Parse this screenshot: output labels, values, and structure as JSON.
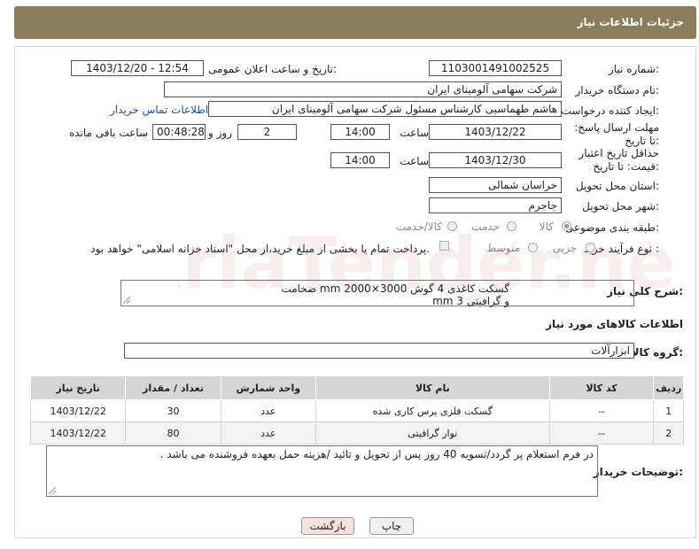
{
  "header": {
    "title": "جزئیات اطلاعات نیاز"
  },
  "form": {
    "need_number_label": "شماره نیاز:",
    "need_number": "1103001491002525",
    "announce_label": "تاریخ و ساعت اعلان عمومی:",
    "announce_value": "1403/12/20 - 12:54",
    "buyer_org_label": "نام دستگاه خریدار:",
    "buyer_org": "شرکت سهامی آلومینای ایران",
    "creator_label": "ایجاد کننده درخواست:",
    "creator": "هاشم طهماسبی کارشناس مسئول شرکت سهامی آلومینای ایران",
    "contact_link": "اطلاعات تماس خریدار",
    "reply_deadline_label": "مهلت ارسال پاسخ: تا تاریخ:",
    "reply_date": "1403/12/22",
    "time_label": "ساعت",
    "reply_time": "14:00",
    "days_value": "2",
    "days_label": "روز و",
    "remaining_value": "00:48:28",
    "remaining_label": "ساعت باقی مانده",
    "price_validity_label": "حداقل تاریخ اعتبار قیمت: تا تاریخ:",
    "validity_date": "1403/12/30",
    "validity_time": "14:00",
    "province_label": "استان محل تحویل:",
    "province": "خراسان شمالی",
    "city_label": "شهر محل تحویل:",
    "city": "جاجرم",
    "category_label": "طبقه بندی موضوعی:",
    "category_options": [
      "کالا",
      "خدمت",
      "کالا/خدمت"
    ],
    "process_label": "نوع فرآیند خرید :",
    "process_options": [
      "جزیی",
      "متوسط"
    ],
    "payment_note": "پرداخت تمام یا بخشی از مبلغ خرید،از محل \"اسناد خزانه اسلامی\" خواهد بود."
  },
  "description": {
    "label": "شرح کلی نیاز:",
    "line1": "گسکت کاغذی 4 گوش mm 2000×3000 ضخامت",
    "line2": "و گرافیتی mm 3"
  },
  "goods_info_title": "اطلاعات کالاهای مورد نیاز",
  "goods_group": {
    "label": "گروه کالا:",
    "value": "ابزارآلات"
  },
  "table": {
    "headers": [
      "ردیف",
      "کد کالا",
      "نام کالا",
      "واحد شمارش",
      "تعداد / مقدار",
      "تاریخ نیاز"
    ],
    "rows": [
      [
        "1",
        "--",
        "گسکت فلزی پرس کاری شده",
        "عدد",
        "30",
        "1403/12/22"
      ],
      [
        "2",
        "--",
        "نوار گرافیتی",
        "عدد",
        "80",
        "1403/12/22"
      ]
    ]
  },
  "buyer_notes": {
    "label": "توضیحات خریدار:",
    "text": "در فرم استعلام پر گردد/تسویه 40 روز پس از تحویل و تائید /هزینه حمل بعهده فروشنده می باشد ."
  },
  "buttons": {
    "print": "چاپ",
    "back": "بازگشت"
  },
  "watermark": "AriaTender.neT"
}
